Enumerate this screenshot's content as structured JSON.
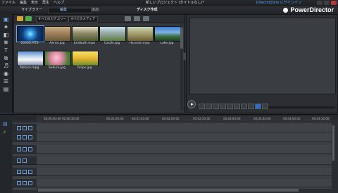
{
  "menu": {
    "items": [
      "ファイル",
      "編集",
      "表示",
      "再生",
      "ヘルプ"
    ],
    "title": "新しいプロジェクト (タイトルなし)*",
    "right_link": "DirectorZone にサインイン"
  },
  "tabs": {
    "library": "ライブラリー",
    "tab2": "編集",
    "tab3": "追加",
    "mode": "ディスク作成"
  },
  "brand": "PowerDirector",
  "library": {
    "filter1": "すべてのカテゴリー",
    "filter2": "すべてのメディア",
    "items": [
      {
        "label": "00000.MTS"
      },
      {
        "label": "Aerial.jpg"
      },
      {
        "label": "birdbath.mpo"
      },
      {
        "label": "Castle.jpg"
      },
      {
        "label": "Harvest.mpo"
      },
      {
        "label": "Lake.jpg"
      },
      {
        "label": "Nature.mpg"
      },
      {
        "label": "Sakura.jpg"
      },
      {
        "label": "Tulips.jpg"
      }
    ]
  },
  "ruler": {
    "ticks": [
      "00;00;00;00",
      "00;00;30;00",
      "00;01;00;00",
      "00;01;30;00",
      "00;02;00;00",
      "00;02;30;00",
      "00;03;00;00",
      "00;03;30;00",
      "00;04;00;00",
      "00;04;30;00",
      "00;05;00;00"
    ]
  },
  "colors": {
    "accent": "#5aa7ff",
    "panel": "#34373b",
    "background": "#2a2d31"
  }
}
